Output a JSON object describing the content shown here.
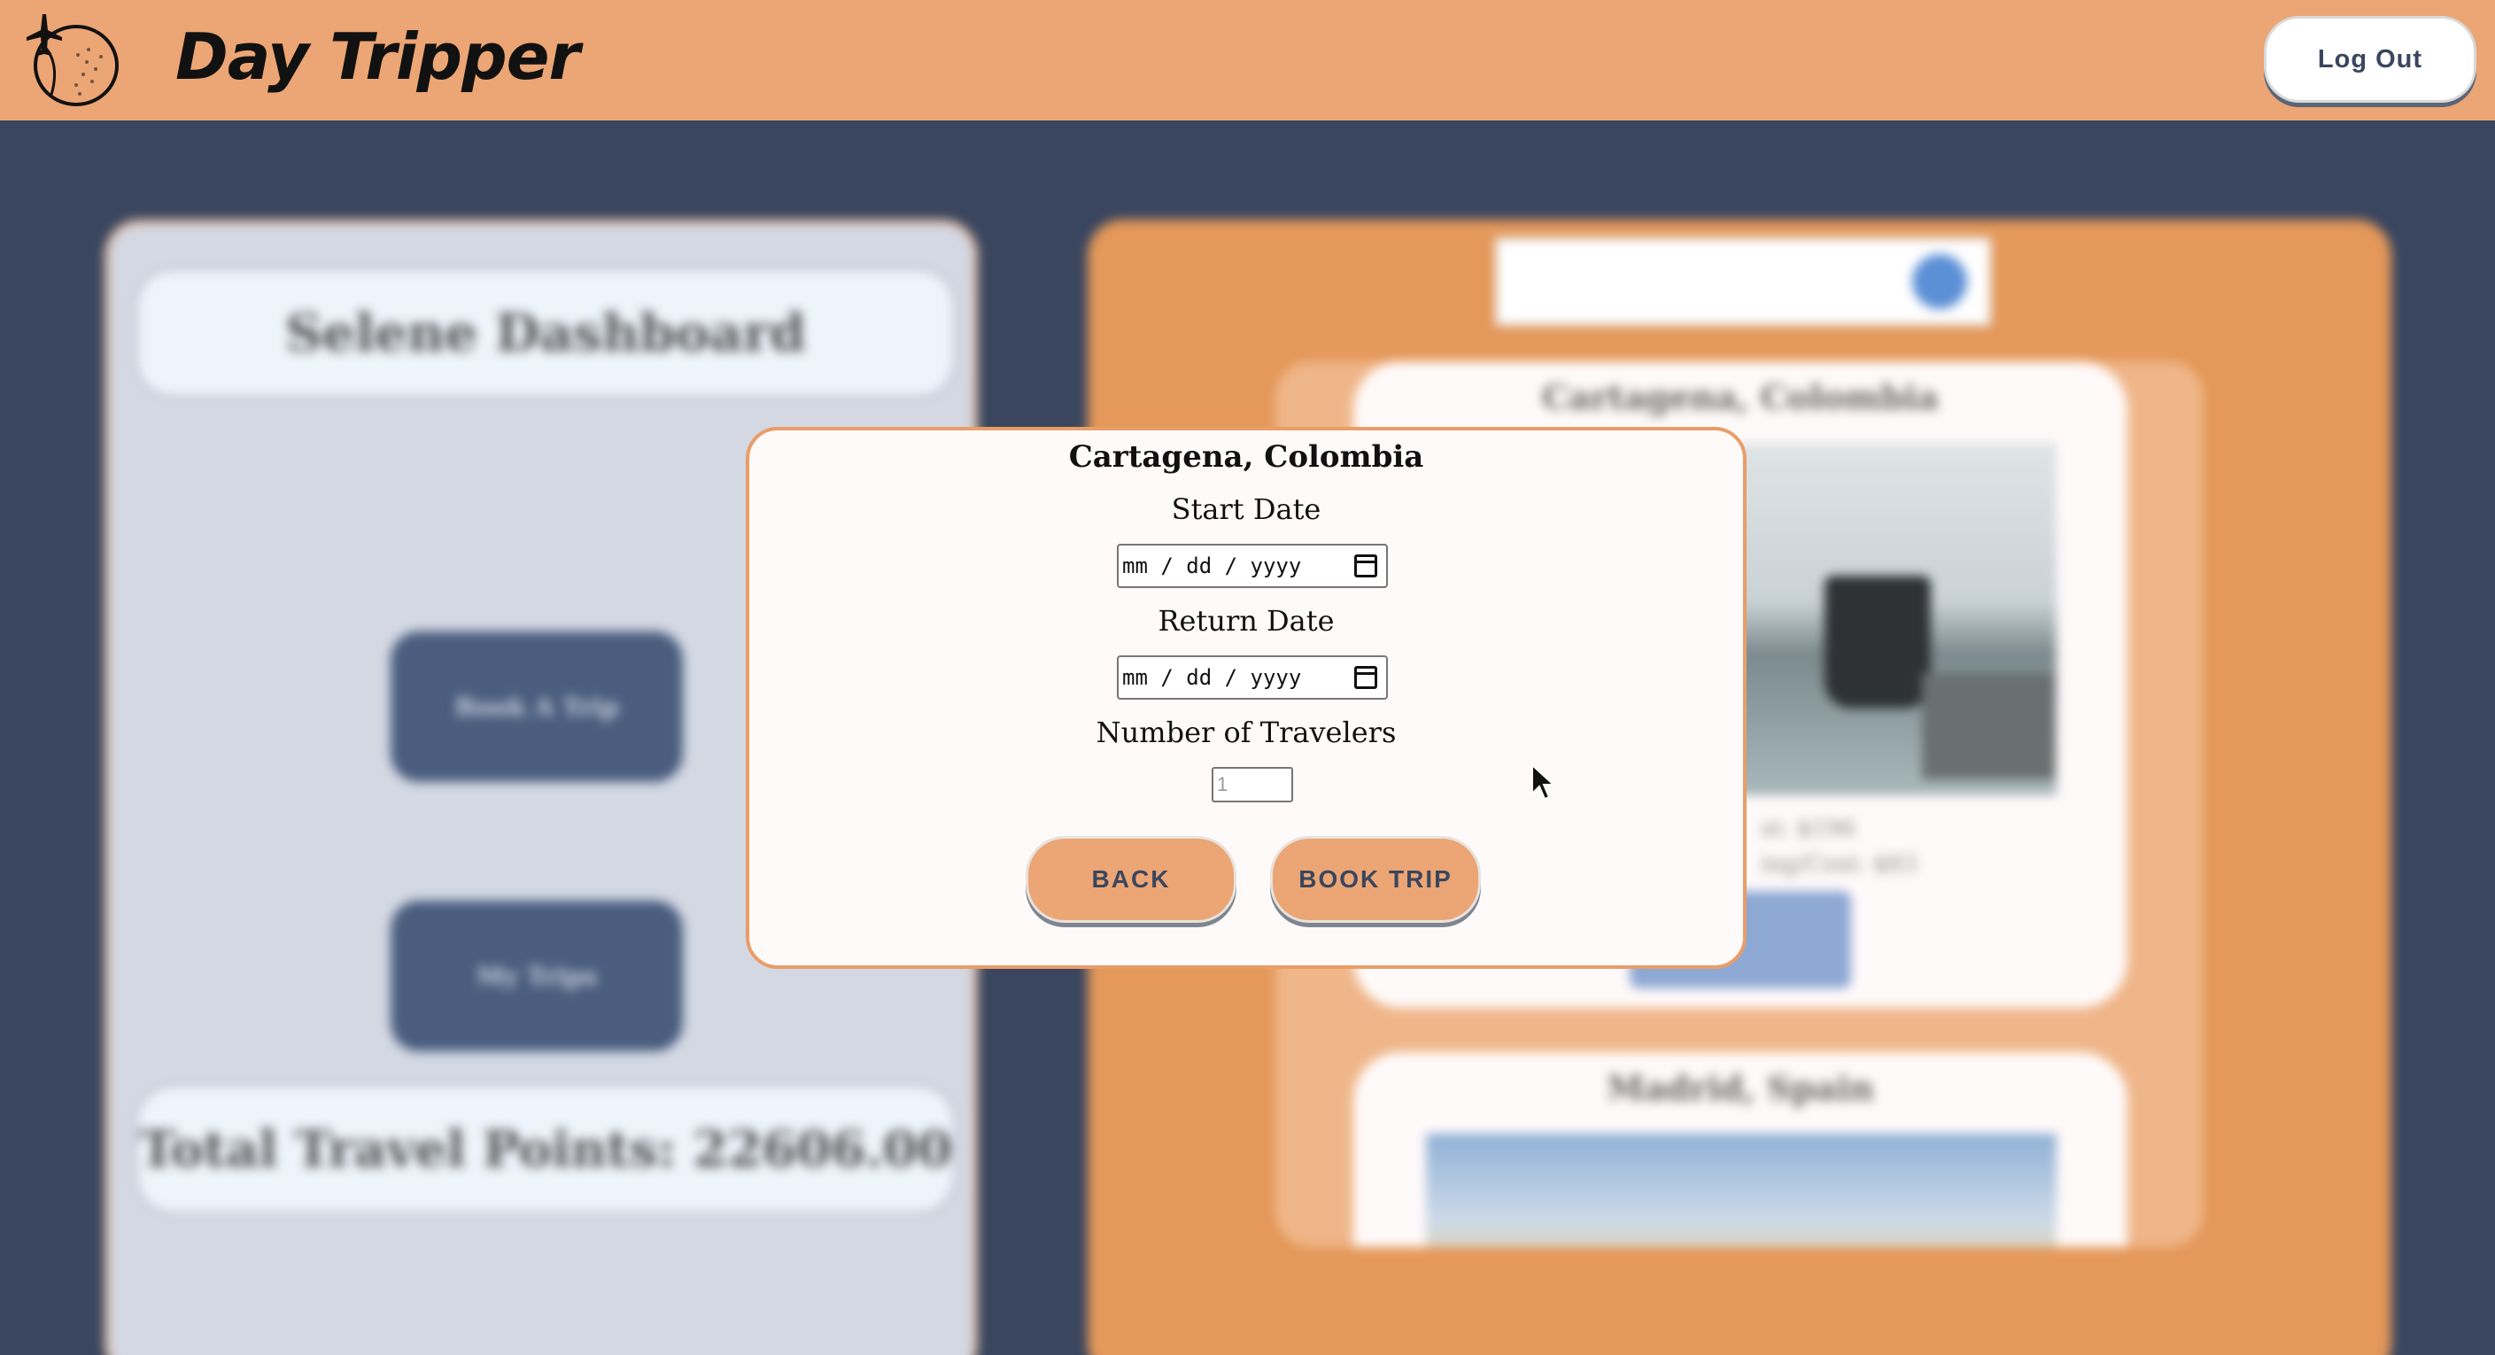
{
  "header": {
    "app_title": "Day Tripper",
    "logout_label": "Log Out"
  },
  "background": {
    "dashboard_title": "Selene Dashboard",
    "book_trip_label": "Book A Trip",
    "my_trips_label": "My Trips",
    "points_text": "Total Travel Points: 22606.00",
    "cards": [
      {
        "title": "Cartagena, Colombia",
        "meta_1": "st: $196",
        "meta_2": "ing/Cost: $83"
      },
      {
        "title": "Madrid, Spain"
      }
    ]
  },
  "modal": {
    "title": "Cartagena, Colombia",
    "start_label": "Start Date",
    "start_value": "mm / dd / yyyy",
    "return_label": "Return Date",
    "return_value": "mm / dd / yyyy",
    "travelers_label": "Number of Travelers",
    "travelers_placeholder": "1",
    "back_label": "BACK",
    "book_label": "BOOK TRIP"
  },
  "colors": {
    "header_bg": "#eca574",
    "page_bg": "#3a465e",
    "accent": "#e4985a"
  }
}
